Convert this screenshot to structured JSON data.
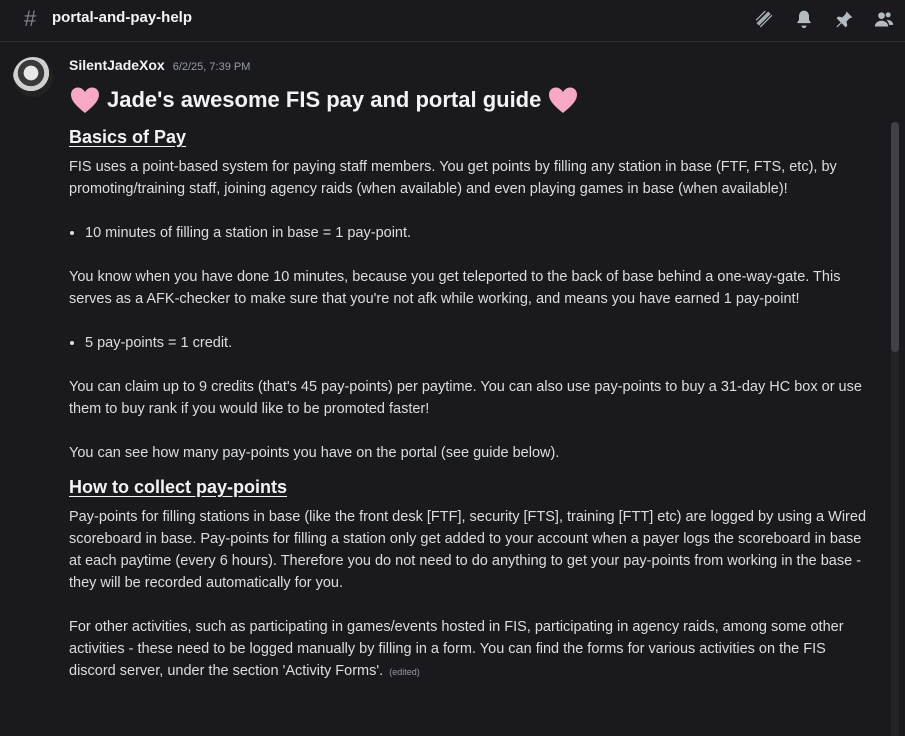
{
  "header": {
    "hash_symbol": "#",
    "channel_name": "portal-and-pay-help",
    "icons": [
      "threads-icon",
      "bell-icon",
      "pin-icon",
      "members-icon"
    ]
  },
  "message": {
    "author": "SilentJadeXox",
    "timestamp": "6/2/25, 7:39 PM",
    "title": "Jade's awesome FIS pay and portal guide",
    "heart_color": "#f7a8c4",
    "section1": {
      "heading": "Basics of Pay",
      "p1": "FIS uses a point-based system for paying staff members. You get points by filling any station in base (FTF, FTS, etc), by promoting/training staff, joining agency raids (when available) and even playing games in base (when available)!",
      "bullet1": "10 minutes of filling a station in base = 1 pay-point.",
      "p2": "You know when you have done 10 minutes, because you get teleported to the back of base behind a one-way-gate. This serves as a AFK-checker to make sure that you're not afk while working, and means you have earned 1 pay-point!",
      "bullet2": "5 pay-points = 1 credit.",
      "p3": "You can claim up to 9 credits (that's 45 pay-points) per paytime. You can also use pay-points to buy a 31-day HC box or use them to buy rank if you would like to be promoted faster!",
      "p4": "You can see how many pay-points you have on the portal (see guide below)."
    },
    "section2": {
      "heading": "How to collect pay-points",
      "p1": "Pay-points for filling stations in base (like the front desk [FTF], security [FTS], training [FTT] etc) are logged by using a Wired scoreboard in base. Pay-points for filling a station only get added to your account when a payer logs the scoreboard in base at each paytime (every 6 hours). Therefore you do not need to do anything to get your pay-points from working in the base - they will be recorded automatically for you.",
      "p2": "For other activities, such as participating in games/events hosted in FIS, participating in agency raids, among some other activities - these need to be logged manually by filling in a form. You can find the forms for various activities on the FIS discord server, under the section 'Activity Forms'.",
      "edited": "(edited)"
    }
  }
}
